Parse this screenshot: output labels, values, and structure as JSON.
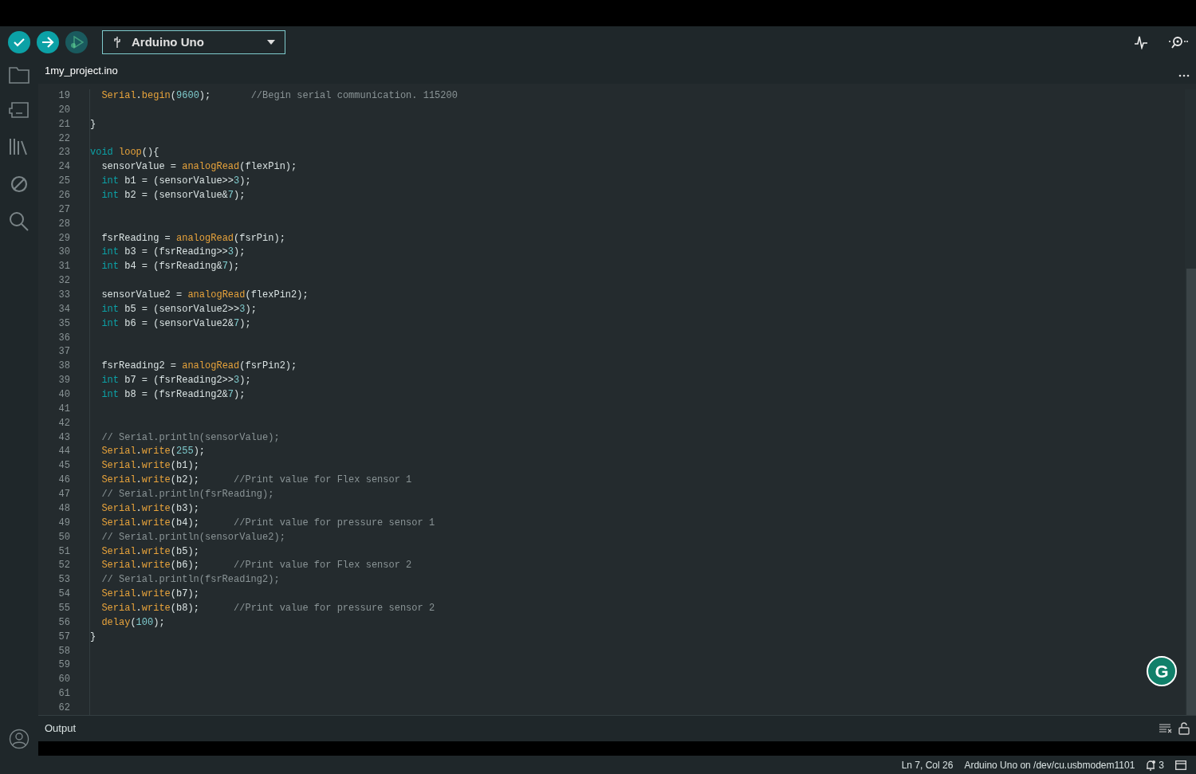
{
  "toolbar": {
    "buttons": [
      {
        "kind": "verify",
        "disabled": false
      },
      {
        "kind": "upload",
        "disabled": false
      },
      {
        "kind": "debug",
        "disabled": true
      }
    ],
    "board": "Arduino Uno"
  },
  "tabs": [
    {
      "label": "1my_project.ino",
      "selected": true
    }
  ],
  "editor": {
    "lines": [
      {
        "number": "19",
        "indented": true,
        "tokens": [
          {
            "kind": "function",
            "text": "Serial"
          },
          {
            "kind": "plain",
            "text": "."
          },
          {
            "kind": "function",
            "text": "begin"
          },
          {
            "kind": "plain",
            "text": "("
          },
          {
            "kind": "number",
            "text": "9600"
          },
          {
            "kind": "plain",
            "text": ");       "
          },
          {
            "kind": "comment",
            "text": "//Begin serial communication. 115200"
          }
        ]
      },
      {
        "number": "20"
      },
      {
        "number": "21",
        "tokens": [
          {
            "kind": "plain",
            "text": "}"
          }
        ]
      },
      {
        "number": "22"
      },
      {
        "number": "23",
        "tokens": [
          {
            "kind": "keyword",
            "text": "void "
          },
          {
            "kind": "function",
            "text": "loop"
          },
          {
            "kind": "plain",
            "text": "(){"
          }
        ]
      },
      {
        "number": "24",
        "indented": true,
        "tokens": [
          {
            "kind": "plain",
            "text": "sensorValue = "
          },
          {
            "kind": "function",
            "text": "analogRead"
          },
          {
            "kind": "plain",
            "text": "(flexPin);"
          }
        ]
      },
      {
        "number": "25",
        "indented": true,
        "tokens": [
          {
            "kind": "keyword",
            "text": "int"
          },
          {
            "kind": "plain",
            "text": " b1 = (sensorValue>>"
          },
          {
            "kind": "number",
            "text": "3"
          },
          {
            "kind": "plain",
            "text": ");"
          }
        ]
      },
      {
        "number": "26",
        "indented": true,
        "tokens": [
          {
            "kind": "keyword",
            "text": "int"
          },
          {
            "kind": "plain",
            "text": " b2 = (sensorValue&"
          },
          {
            "kind": "number",
            "text": "7"
          },
          {
            "kind": "plain",
            "text": ");"
          }
        ]
      },
      {
        "number": "27"
      },
      {
        "number": "28"
      },
      {
        "number": "29",
        "indented": true,
        "tokens": [
          {
            "kind": "plain",
            "text": "fsrReading = "
          },
          {
            "kind": "function",
            "text": "analogRead"
          },
          {
            "kind": "plain",
            "text": "(fsrPin);"
          }
        ]
      },
      {
        "number": "30",
        "indented": true,
        "tokens": [
          {
            "kind": "keyword",
            "text": "int"
          },
          {
            "kind": "plain",
            "text": " b3 = (fsrReading>>"
          },
          {
            "kind": "number",
            "text": "3"
          },
          {
            "kind": "plain",
            "text": ");"
          }
        ]
      },
      {
        "number": "31",
        "indented": true,
        "tokens": [
          {
            "kind": "keyword",
            "text": "int"
          },
          {
            "kind": "plain",
            "text": " b4 = (fsrReading&"
          },
          {
            "kind": "number",
            "text": "7"
          },
          {
            "kind": "plain",
            "text": ");"
          }
        ]
      },
      {
        "number": "32"
      },
      {
        "number": "33",
        "indented": true,
        "tokens": [
          {
            "kind": "plain",
            "text": "sensorValue2 = "
          },
          {
            "kind": "function",
            "text": "analogRead"
          },
          {
            "kind": "plain",
            "text": "(flexPin2);"
          }
        ]
      },
      {
        "number": "34",
        "indented": true,
        "tokens": [
          {
            "kind": "keyword",
            "text": "int"
          },
          {
            "kind": "plain",
            "text": " b5 = (sensorValue2>>"
          },
          {
            "kind": "number",
            "text": "3"
          },
          {
            "kind": "plain",
            "text": ");"
          }
        ]
      },
      {
        "number": "35",
        "indented": true,
        "tokens": [
          {
            "kind": "keyword",
            "text": "int"
          },
          {
            "kind": "plain",
            "text": " b6 = (sensorValue2&"
          },
          {
            "kind": "number",
            "text": "7"
          },
          {
            "kind": "plain",
            "text": ");"
          }
        ]
      },
      {
        "number": "36"
      },
      {
        "number": "37"
      },
      {
        "number": "38",
        "indented": true,
        "tokens": [
          {
            "kind": "plain",
            "text": "fsrReading2 = "
          },
          {
            "kind": "function",
            "text": "analogRead"
          },
          {
            "kind": "plain",
            "text": "(fsrPin2);"
          }
        ]
      },
      {
        "number": "39",
        "indented": true,
        "tokens": [
          {
            "kind": "keyword",
            "text": "int"
          },
          {
            "kind": "plain",
            "text": " b7 = (fsrReading2>>"
          },
          {
            "kind": "number",
            "text": "3"
          },
          {
            "kind": "plain",
            "text": ");"
          }
        ]
      },
      {
        "number": "40",
        "indented": true,
        "tokens": [
          {
            "kind": "keyword",
            "text": "int"
          },
          {
            "kind": "plain",
            "text": " b8 = (fsrReading2&"
          },
          {
            "kind": "number",
            "text": "7"
          },
          {
            "kind": "plain",
            "text": ");"
          }
        ]
      },
      {
        "number": "41"
      },
      {
        "number": "42"
      },
      {
        "number": "43",
        "indented": true,
        "tokens": [
          {
            "kind": "comment",
            "text": "// Serial.println(sensorValue);"
          }
        ]
      },
      {
        "number": "44",
        "indented": true,
        "tokens": [
          {
            "kind": "function",
            "text": "Serial"
          },
          {
            "kind": "plain",
            "text": "."
          },
          {
            "kind": "function",
            "text": "write"
          },
          {
            "kind": "plain",
            "text": "("
          },
          {
            "kind": "number",
            "text": "255"
          },
          {
            "kind": "plain",
            "text": ");"
          }
        ]
      },
      {
        "number": "45",
        "indented": true,
        "tokens": [
          {
            "kind": "function",
            "text": "Serial"
          },
          {
            "kind": "plain",
            "text": "."
          },
          {
            "kind": "function",
            "text": "write"
          },
          {
            "kind": "plain",
            "text": "(b1);"
          }
        ]
      },
      {
        "number": "46",
        "indented": true,
        "tokens": [
          {
            "kind": "function",
            "text": "Serial"
          },
          {
            "kind": "plain",
            "text": "."
          },
          {
            "kind": "function",
            "text": "write"
          },
          {
            "kind": "plain",
            "text": "(b2);      "
          },
          {
            "kind": "comment",
            "text": "//Print value for Flex sensor 1"
          }
        ]
      },
      {
        "number": "47",
        "indented": true,
        "tokens": [
          {
            "kind": "comment",
            "text": "// Serial.println(fsrReading);"
          }
        ]
      },
      {
        "number": "48",
        "indented": true,
        "tokens": [
          {
            "kind": "function",
            "text": "Serial"
          },
          {
            "kind": "plain",
            "text": "."
          },
          {
            "kind": "function",
            "text": "write"
          },
          {
            "kind": "plain",
            "text": "(b3);"
          }
        ]
      },
      {
        "number": "49",
        "indented": true,
        "tokens": [
          {
            "kind": "function",
            "text": "Serial"
          },
          {
            "kind": "plain",
            "text": "."
          },
          {
            "kind": "function",
            "text": "write"
          },
          {
            "kind": "plain",
            "text": "(b4);      "
          },
          {
            "kind": "comment",
            "text": "//Print value for pressure sensor 1"
          }
        ]
      },
      {
        "number": "50",
        "indented": true,
        "tokens": [
          {
            "kind": "comment",
            "text": "// Serial.println(sensorValue2);"
          }
        ]
      },
      {
        "number": "51",
        "indented": true,
        "tokens": [
          {
            "kind": "function",
            "text": "Serial"
          },
          {
            "kind": "plain",
            "text": "."
          },
          {
            "kind": "function",
            "text": "write"
          },
          {
            "kind": "plain",
            "text": "(b5);"
          }
        ]
      },
      {
        "number": "52",
        "indented": true,
        "tokens": [
          {
            "kind": "function",
            "text": "Serial"
          },
          {
            "kind": "plain",
            "text": "."
          },
          {
            "kind": "function",
            "text": "write"
          },
          {
            "kind": "plain",
            "text": "(b6);      "
          },
          {
            "kind": "comment",
            "text": "//Print value for Flex sensor 2"
          }
        ]
      },
      {
        "number": "53",
        "indented": true,
        "tokens": [
          {
            "kind": "comment",
            "text": "// Serial.println(fsrReading2);"
          }
        ]
      },
      {
        "number": "54",
        "indented": true,
        "tokens": [
          {
            "kind": "function",
            "text": "Serial"
          },
          {
            "kind": "plain",
            "text": "."
          },
          {
            "kind": "function",
            "text": "write"
          },
          {
            "kind": "plain",
            "text": "(b7);"
          }
        ]
      },
      {
        "number": "55",
        "indented": true,
        "tokens": [
          {
            "kind": "function",
            "text": "Serial"
          },
          {
            "kind": "plain",
            "text": "."
          },
          {
            "kind": "function",
            "text": "write"
          },
          {
            "kind": "plain",
            "text": "(b8);      "
          },
          {
            "kind": "comment",
            "text": "//Print value for pressure sensor 2"
          }
        ]
      },
      {
        "number": "56",
        "indented": true,
        "tokens": [
          {
            "kind": "function",
            "text": "delay"
          },
          {
            "kind": "plain",
            "text": "("
          },
          {
            "kind": "number",
            "text": "100"
          },
          {
            "kind": "plain",
            "text": ");"
          }
        ]
      },
      {
        "number": "57",
        "tokens": [
          {
            "kind": "plain",
            "text": "}"
          }
        ]
      },
      {
        "number": "58"
      },
      {
        "number": "59"
      },
      {
        "number": "60"
      },
      {
        "number": "61"
      },
      {
        "number": "62"
      }
    ]
  },
  "floating_button": {
    "label": "G"
  },
  "output": {
    "title": "Output"
  },
  "status_bar": {
    "position": "Ln 7, Col 26",
    "board": "Arduino Uno on /dev/cu.usbmodem1101",
    "notifications": "3"
  }
}
